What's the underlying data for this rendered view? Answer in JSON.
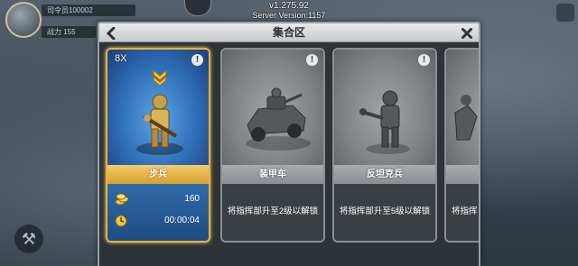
{
  "hud": {
    "player_name": "司令员100002",
    "power_text": "战力 155",
    "version": "v1.275.92",
    "server_version": "Server Version:1157"
  },
  "panel": {
    "title": "集合区",
    "back_icon": "chevron-left-icon",
    "close_icon": "close-icon"
  },
  "cards": [
    {
      "name": "步兵",
      "count": "8X",
      "state": "selected",
      "rank_icon": "rank-chevron-icon",
      "cost_icon": "gold-coins-icon",
      "cost": "160",
      "time_icon": "clock-icon",
      "time": "00:00:04",
      "unlock_text": ""
    },
    {
      "name": "装甲车",
      "state": "locked",
      "unlock_text": "将指挥部升至2级以解锁"
    },
    {
      "name": "反坦克兵",
      "state": "locked",
      "unlock_text": "将指挥部升至5级以解锁"
    },
    {
      "name": "",
      "state": "locked",
      "unlock_text": "将指挥"
    }
  ],
  "colors": {
    "selected_border": "#e6b33f",
    "selected_band": "#d79f2c",
    "selected_art": "#2e6cb6",
    "locked_band": "#8a8e92",
    "panel_bg": "#2e3338",
    "header_bg": "#d8d9db"
  }
}
